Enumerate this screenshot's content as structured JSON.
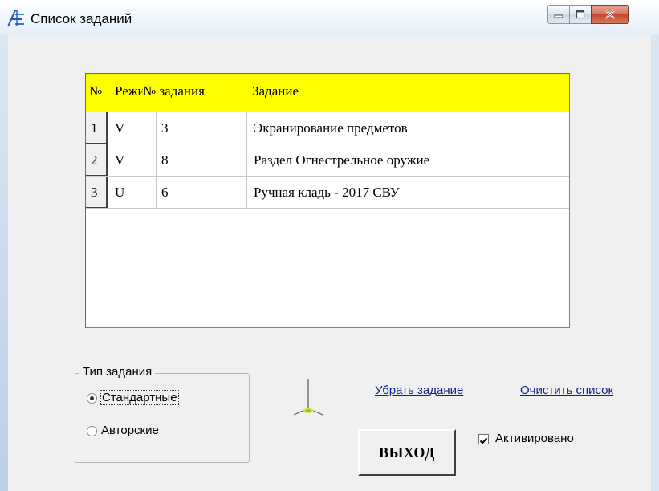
{
  "window": {
    "title": "Список заданий"
  },
  "grid": {
    "columns": [
      "№",
      "Режи",
      "№ задания",
      "Задание"
    ],
    "rows": [
      {
        "num": "1",
        "mode": "V",
        "task_no": "3",
        "task": "Экранирование предметов"
      },
      {
        "num": "2",
        "mode": "V",
        "task_no": "8",
        "task": "Раздел Огнестрельное оружие"
      },
      {
        "num": "3",
        "mode": "U",
        "task_no": "6",
        "task": "Ручная кладь - 2017  СВУ"
      }
    ],
    "header_color": "#ffff00"
  },
  "task_type": {
    "label": "Тип задания",
    "options": [
      {
        "label": "Стандартные",
        "selected": true
      },
      {
        "label": "Авторские",
        "selected": false
      }
    ]
  },
  "links": {
    "remove_task": "Убрать задание",
    "clear_list": "Очистить список"
  },
  "exit_button": "ВЫХОД",
  "activated": {
    "label": "Активировано",
    "checked": true
  }
}
